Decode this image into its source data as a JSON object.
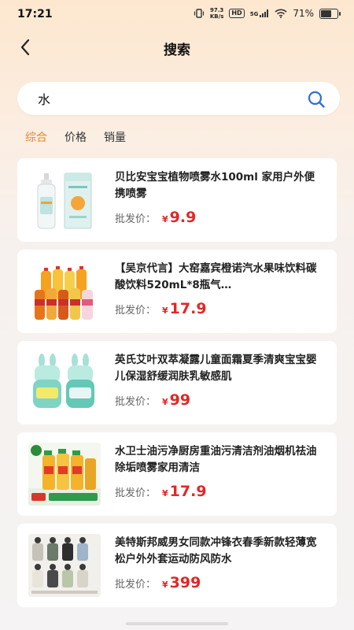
{
  "status_bar": {
    "time": "17:21",
    "net_speed_value": "97.3",
    "net_speed_unit": "KB/s",
    "hd": "HD",
    "signal": "5G",
    "battery_text": "71%",
    "battery_level": 0.71
  },
  "nav": {
    "title": "搜索",
    "back_icon": "chevron-left-icon"
  },
  "search": {
    "value": "水",
    "icon": "search-icon"
  },
  "tabs": [
    {
      "label": "综合",
      "active": true
    },
    {
      "label": "价格",
      "active": false
    },
    {
      "label": "销量",
      "active": false
    }
  ],
  "colors": {
    "accent": "#e8872a",
    "price": "#e02828",
    "search_icon": "#2f6fd6"
  },
  "price_label": "批发价：",
  "currency": "¥",
  "products": [
    {
      "title": "贝比安宝宝植物喷雾水100ml 家用户外便携喷雾",
      "price": "9.9",
      "image": "spray-bottle-image"
    },
    {
      "title": "【吴京代言】大窑嘉宾橙诺汽水果味饮料碳酸饮料520mL*8瓶气…",
      "price": "17.9",
      "image": "soda-bottles-image"
    },
    {
      "title": "英氏艾叶双萃凝露儿童面霜夏季清爽宝宝婴儿保湿舒缓润肤乳敏感肌",
      "price": "99",
      "image": "cream-jars-image"
    },
    {
      "title": "水卫士油污净厨房重油污清洁剂油烟机祛油除垢喷雾家用清洁",
      "price": "17.9",
      "image": "cleaner-sprays-image"
    },
    {
      "title": "美特斯邦威男女同款冲锋衣春季新款轻薄宽松户外外套运动防风防水",
      "price": "399",
      "image": "jackets-image"
    }
  ]
}
